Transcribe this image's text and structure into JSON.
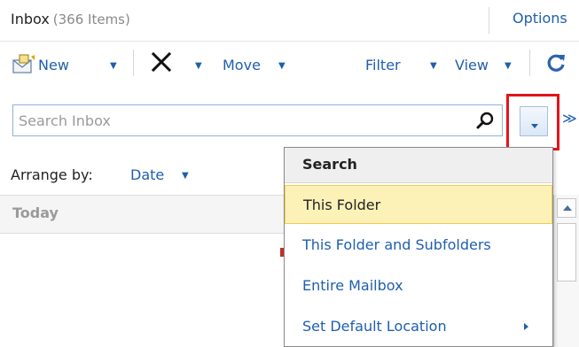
{
  "header": {
    "folder_name": "Inbox",
    "item_count": "(366 Items)",
    "options_label": "Options"
  },
  "toolbar": {
    "new_label": "New",
    "move_label": "Move",
    "filter_label": "Filter",
    "view_label": "View",
    "icons": [
      "new-message-icon",
      "delete-icon",
      "refresh-icon"
    ]
  },
  "search": {
    "placeholder": "Search Inbox",
    "value": ""
  },
  "arrange": {
    "label": "Arrange by:",
    "value": "Date"
  },
  "list": {
    "group_label": "Today"
  },
  "search_menu": {
    "header": "Search",
    "items": [
      {
        "label": "This Folder",
        "selected": true
      },
      {
        "label": "This Folder and Subfolders",
        "selected": false
      },
      {
        "label": "Entire Mailbox",
        "selected": false
      },
      {
        "label": "Set Default Location",
        "selected": false,
        "has_submenu": true
      }
    ]
  },
  "colors": {
    "link": "#1f5fae",
    "highlight_border": "#e3141b",
    "selected_bg": "#fcf2b8"
  }
}
